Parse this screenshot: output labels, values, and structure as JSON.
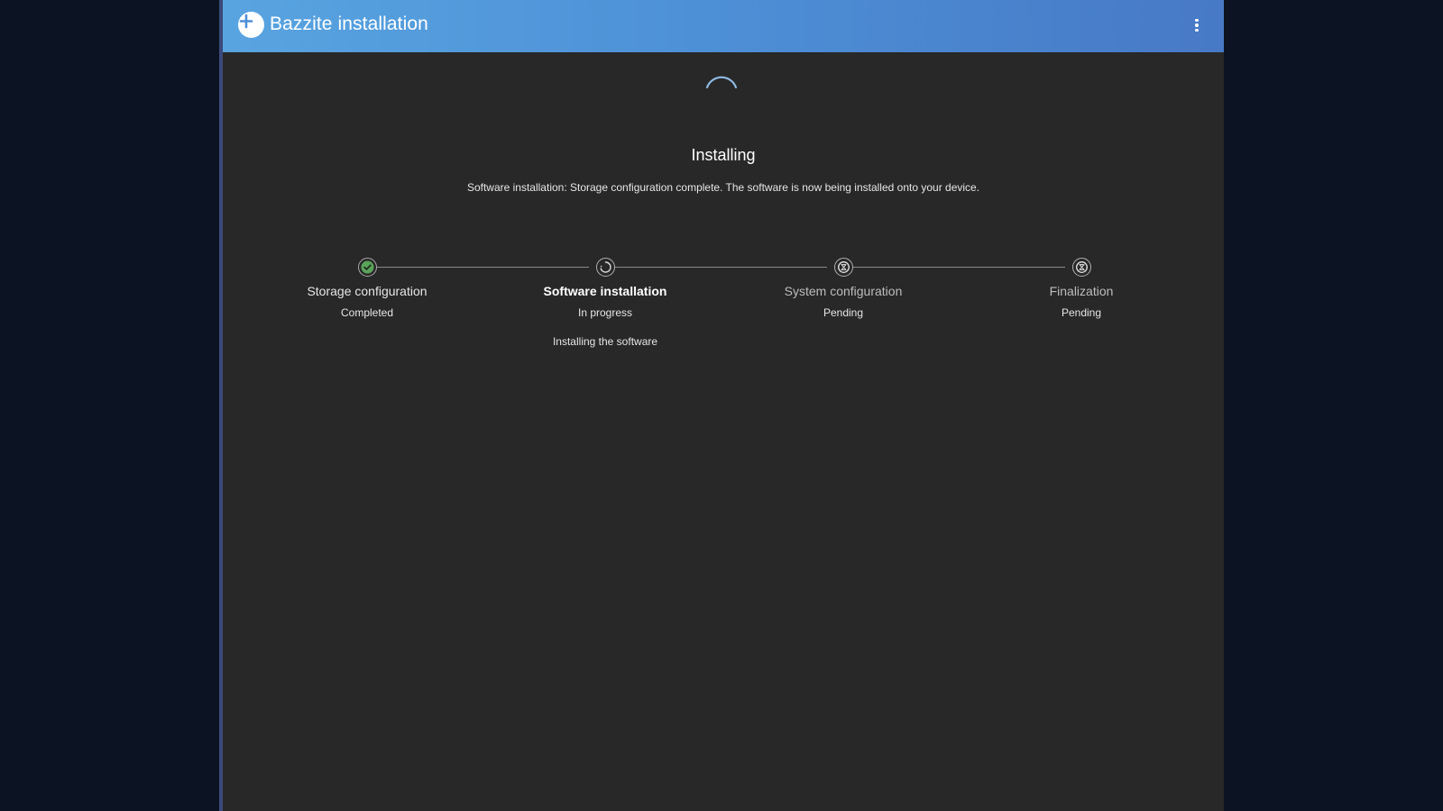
{
  "app": {
    "title": "Bazzite installation",
    "menu_icon": "kebab-menu-icon",
    "logo_icon": "bazzite-logo-icon"
  },
  "progress": {
    "heading": "Installing",
    "message": "Software installation: Storage configuration complete. The software is now being installed onto your device."
  },
  "steps": [
    {
      "title": "Storage configuration",
      "status": "Completed",
      "detail": "",
      "icon": "check-circle-icon"
    },
    {
      "title": "Software installation",
      "status": "In progress",
      "detail": "Installing the software",
      "icon": "spinner-icon"
    },
    {
      "title": "System configuration",
      "status": "Pending",
      "detail": "",
      "icon": "pending-icon"
    },
    {
      "title": "Finalization",
      "status": "Pending",
      "detail": "",
      "icon": "pending-icon"
    }
  ],
  "colors": {
    "header_start": "#58a4e0",
    "header_end": "#4779c6",
    "window_bg": "#282828",
    "success": "#5ba35b",
    "spinner": "#8fb8e0"
  }
}
